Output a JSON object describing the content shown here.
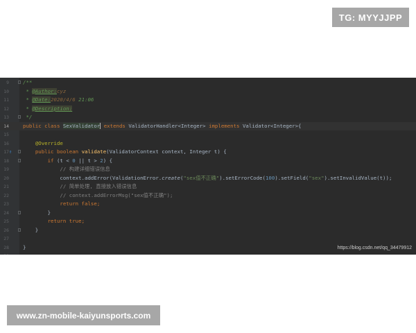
{
  "watermarks": {
    "top": "TG: MYYJJPP",
    "bottom": "www.zn-mobile-kaiyunsports.com"
  },
  "editor": {
    "current_line": 14,
    "source_url": "https://blog.csdn.net/qq_34479912",
    "lines": [
      {
        "no": "9",
        "tokens": [
          {
            "t": "/**",
            "c": "doc"
          }
        ]
      },
      {
        "no": "10",
        "tokens": [
          {
            "t": " * ",
            "c": "doc"
          },
          {
            "t": "@Author:",
            "c": "tag"
          },
          {
            "t": "cyz",
            "c": "tagv"
          }
        ]
      },
      {
        "no": "11",
        "tokens": [
          {
            "t": " * ",
            "c": "doc"
          },
          {
            "t": "@Date:",
            "c": "tag"
          },
          {
            "t": "2020/4/6",
            "c": "tagv"
          },
          {
            "t": " 21:06",
            "c": "doc"
          }
        ]
      },
      {
        "no": "12",
        "tokens": [
          {
            "t": " * ",
            "c": "doc"
          },
          {
            "t": "@Description:",
            "c": "tag"
          }
        ]
      },
      {
        "no": "13",
        "tokens": [
          {
            "t": " */",
            "c": "doc"
          }
        ]
      },
      {
        "no": "14",
        "tokens": [
          {
            "t": "public class ",
            "c": "kw"
          },
          {
            "t": "SexValidator",
            "c": "hl"
          },
          {
            "t": " extends ",
            "c": "kw"
          },
          {
            "t": "ValidatorHandler<Integer> ",
            "c": ""
          },
          {
            "t": "implements ",
            "c": "kw"
          },
          {
            "t": "Validator<Integer>{",
            "c": ""
          }
        ]
      },
      {
        "no": "15",
        "tokens": []
      },
      {
        "no": "16",
        "tokens": [
          {
            "t": "    ",
            "c": ""
          },
          {
            "t": "@Override",
            "c": "ann"
          }
        ]
      },
      {
        "no": "17",
        "tokens": [
          {
            "t": "    ",
            "c": ""
          },
          {
            "t": "public boolean ",
            "c": "kw"
          },
          {
            "t": "validate",
            "c": "fn"
          },
          {
            "t": "(ValidatorContext context, Integer t) {",
            "c": ""
          }
        ]
      },
      {
        "no": "18",
        "tokens": [
          {
            "t": "        ",
            "c": ""
          },
          {
            "t": "if ",
            "c": "kw"
          },
          {
            "t": "(t < ",
            "c": ""
          },
          {
            "t": "0",
            "c": "num"
          },
          {
            "t": " || t > ",
            "c": ""
          },
          {
            "t": "2",
            "c": "num"
          },
          {
            "t": ") {",
            "c": ""
          }
        ]
      },
      {
        "no": "19",
        "tokens": [
          {
            "t": "            ",
            "c": ""
          },
          {
            "t": "// 构建详细错误信息",
            "c": "cm-cn"
          }
        ]
      },
      {
        "no": "20",
        "tokens": [
          {
            "t": "            context.addError(ValidationError.",
            "c": ""
          },
          {
            "t": "create",
            "c": "it"
          },
          {
            "t": "(",
            "c": ""
          },
          {
            "t": "\"sex值不正确\"",
            "c": "str"
          },
          {
            "t": ").setErrorCode(",
            "c": ""
          },
          {
            "t": "100",
            "c": "num"
          },
          {
            "t": ").setField(",
            "c": ""
          },
          {
            "t": "\"sex\"",
            "c": "str"
          },
          {
            "t": ").setInvalidValue(t));",
            "c": ""
          }
        ]
      },
      {
        "no": "21",
        "tokens": [
          {
            "t": "            ",
            "c": ""
          },
          {
            "t": "// 简单处理, 直接放入错误信息",
            "c": "cm-cn"
          }
        ]
      },
      {
        "no": "22",
        "tokens": [
          {
            "t": "            ",
            "c": ""
          },
          {
            "t": "// context.addErrorMsg(\"sex值不正确\");",
            "c": "cm-cn"
          }
        ]
      },
      {
        "no": "23",
        "tokens": [
          {
            "t": "            ",
            "c": ""
          },
          {
            "t": "return false",
            "c": "kw"
          },
          {
            "t": ";",
            "c": "kw"
          }
        ]
      },
      {
        "no": "24",
        "tokens": [
          {
            "t": "        }",
            "c": ""
          }
        ]
      },
      {
        "no": "25",
        "tokens": [
          {
            "t": "        ",
            "c": ""
          },
          {
            "t": "return true",
            "c": "kw"
          },
          {
            "t": ";",
            "c": "kw"
          }
        ]
      },
      {
        "no": "26",
        "tokens": [
          {
            "t": "    }",
            "c": ""
          }
        ]
      },
      {
        "no": "27",
        "tokens": []
      },
      {
        "no": "28",
        "tokens": [
          {
            "t": "}",
            "c": ""
          }
        ]
      },
      {
        "no": "29",
        "tokens": []
      }
    ],
    "fold_lines": [
      "9",
      "13",
      "17",
      "18",
      "24",
      "26"
    ],
    "override_icon_line": "17",
    "icons": {
      "override": "override-gutter-icon"
    }
  },
  "colors": {
    "editor_bg": "#2b2b2b",
    "gutter_bg": "#313335",
    "keyword": "#cc7832",
    "string": "#6a8759",
    "number": "#6897bb",
    "method": "#ffc66d",
    "annotation": "#bbb529",
    "doc_comment": "#629755"
  }
}
